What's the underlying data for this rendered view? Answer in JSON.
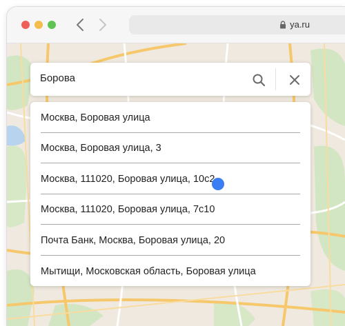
{
  "browser": {
    "url": "ya.ru"
  },
  "search": {
    "query": "Борова"
  },
  "suggestions": [
    "Москва, Боровая улица",
    "Москва, Боровая улица, 3",
    "Москва, 111020, Боровая улица, 10с2",
    "Москва, 111020, Боровая улица, 7с10",
    "Почта Банк, Москва, Боровая улица, 20",
    "Мытищи, Московская область, Боровая улица"
  ],
  "colors": {
    "cursor": "#3b7df2",
    "map_background": "#efe9df"
  }
}
